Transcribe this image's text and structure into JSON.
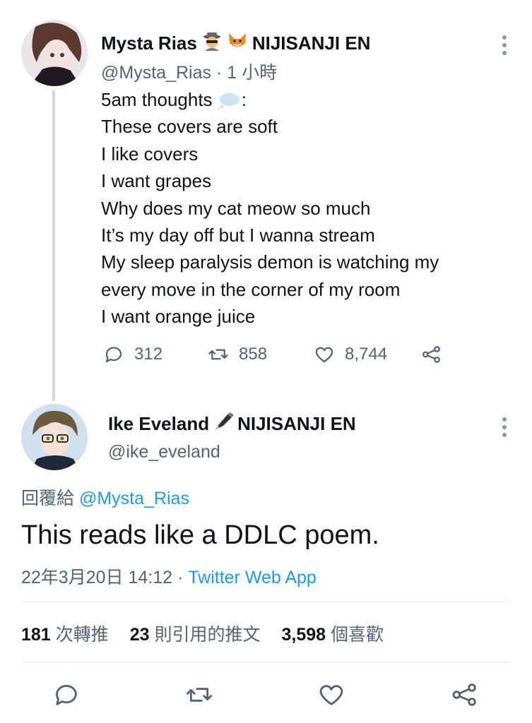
{
  "tweet1": {
    "display_name": "Mysta Rias",
    "badge_text": "NIJISANJI EN",
    "handle": "@Mysta_Rias",
    "separator": "·",
    "time_ago": "1 小時",
    "lines": [
      "5am thoughts",
      "These covers are soft",
      "I like covers",
      "I want grapes",
      "Why does my cat meow so much",
      "It’s my day off but I wanna stream",
      "My sleep paralysis demon is watching my",
      "every move in the corner of my room",
      "I want orange juice"
    ],
    "first_line_suffix": ":",
    "replies": "312",
    "retweets": "858",
    "likes": "8,744"
  },
  "tweet2": {
    "display_name": "Ike Eveland",
    "badge_text": "NIJISANJI EN",
    "handle": "@ike_eveland",
    "reply_to_prefix": "回覆給",
    "reply_to_handle": "@Mysta_Rias",
    "text": "This reads like a DDLC poem.",
    "date": "22年3月20日 14:12",
    "separator": "·",
    "source": "Twitter Web App",
    "stats": {
      "retweets_count": "181",
      "retweets_label": "次轉推",
      "quotes_count": "23",
      "quotes_label": "則引用的推文",
      "likes_count": "3,598",
      "likes_label": "個喜歡"
    }
  },
  "colors": {
    "text": "#0f1419",
    "secondary": "#536471",
    "link": "#1d9bf0",
    "divider": "#e6ecf0"
  },
  "icons": [
    "more-icon",
    "reply-icon",
    "retweet-icon",
    "like-icon",
    "share-icon",
    "detective-emoji-icon",
    "fox-emoji-icon",
    "thought-bubble-icon",
    "fountain-pen-icon"
  ]
}
